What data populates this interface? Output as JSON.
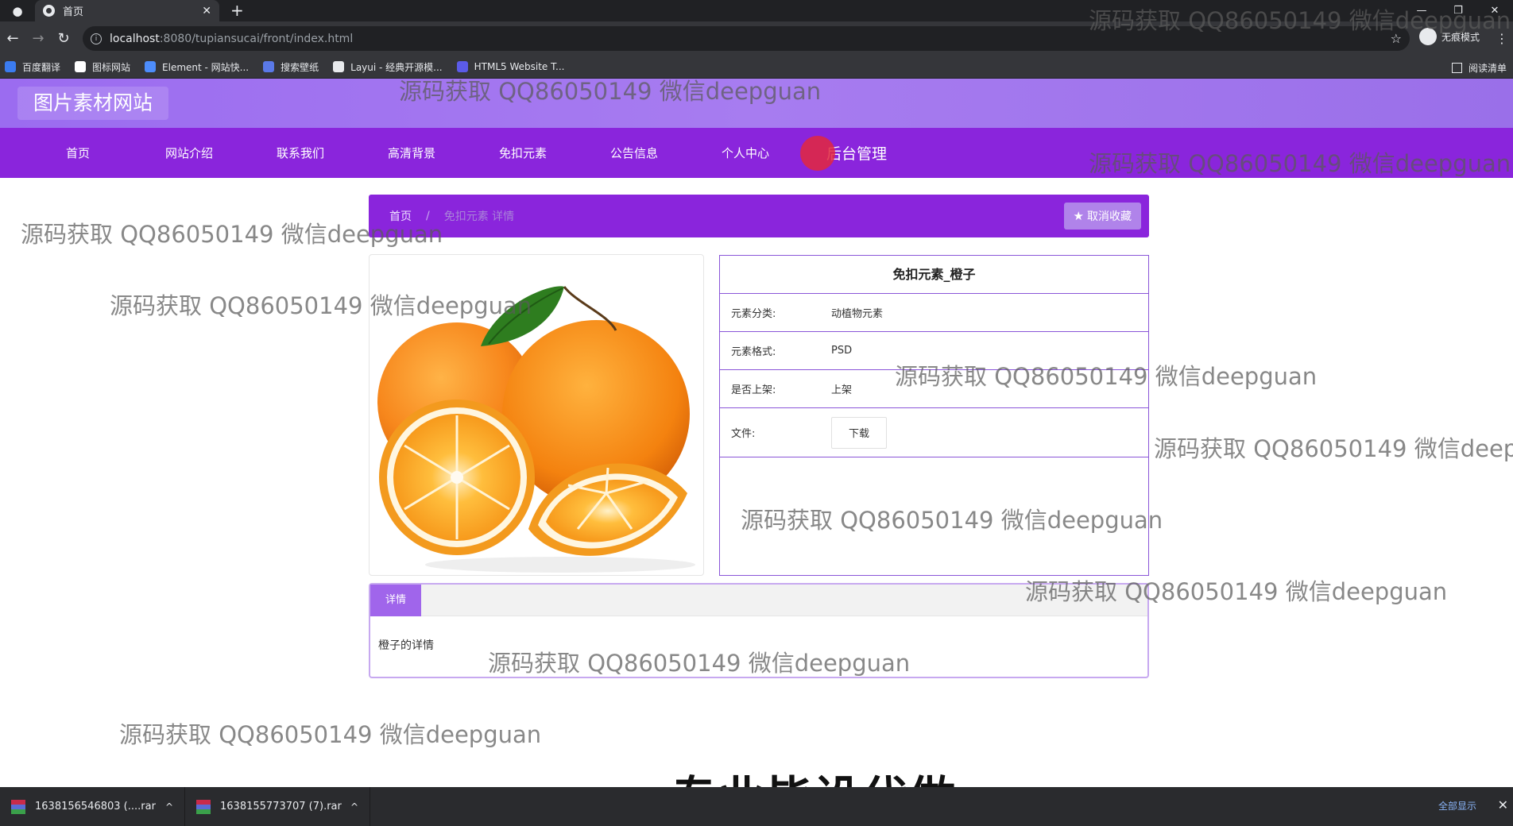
{
  "browser": {
    "tab_title": "首页",
    "tab_close": "✕",
    "new_tab": "+",
    "window_controls": [
      "—",
      "❐",
      "✕"
    ],
    "url_host": "localhost",
    "url_rest": ":8080/tupiansucai/front/index.html",
    "incognito_label": "无痕模式",
    "bookmarks": [
      {
        "label": "百度翻译",
        "color": "#3b7cf0"
      },
      {
        "label": "图标网站",
        "color": "#ffffff"
      },
      {
        "label": "Element - 网站快...",
        "color": "#4d8dfc"
      },
      {
        "label": "搜索壁纸",
        "color": "#5a79e8"
      },
      {
        "label": "Layui - 经典开源模...",
        "color": "#e8eaed"
      },
      {
        "label": "HTML5 Website T...",
        "color": "#5b5be8"
      }
    ],
    "reading_list": "阅读清单"
  },
  "site": {
    "title": "图片素材网站",
    "nav": [
      "首页",
      "网站介绍",
      "联系我们",
      "高清背景",
      "免扣元素",
      "公告信息",
      "个人中心",
      "后台管理"
    ]
  },
  "breadcrumb": {
    "home": "首页",
    "separator": "/",
    "current": "免扣元素 详情",
    "unfavorite_label": "取消收藏"
  },
  "element": {
    "title": "免扣元素_橙子",
    "fields": [
      {
        "label": "元素分类:",
        "value": "动植物元素"
      },
      {
        "label": "元素格式:",
        "value": "PSD"
      },
      {
        "label": "是否上架:",
        "value": "上架"
      }
    ],
    "file_label": "文件:",
    "download_label": "下载"
  },
  "detail": {
    "tab_label": "详情",
    "content": "橙子的详情"
  },
  "watermark_text": "源码获取 QQ86050149 微信deepguan",
  "caption": "专业毕设代做",
  "downloads": {
    "items": [
      "1638156546803 (....rar",
      "1638155773707 (7).rar"
    ],
    "show_all": "全部显示"
  },
  "colors": {
    "nav_purple": "#8a25dc",
    "header_purple": "#a77cf0",
    "border_purple": "#8a55d8"
  }
}
